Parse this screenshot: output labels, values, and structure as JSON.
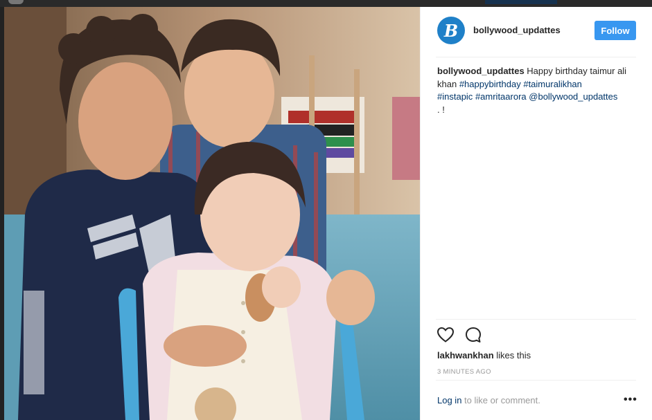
{
  "post": {
    "username": "bollywood_updattes",
    "avatar_letter": "B",
    "follow_label": "Follow",
    "caption": {
      "user": "bollywood_updattes",
      "text": " Happy birthday taimur ali khan ",
      "tags": [
        "#happybirthday",
        "#taimuralikhan",
        "#instapic",
        "#amritaarora",
        "@bollywood_updattes"
      ],
      "trailing": " . !"
    },
    "likes": {
      "liker": "lakhwankhan",
      "suffix": " likes this"
    },
    "timestamp": "3 MINUTES AGO",
    "login": {
      "link": "Log in",
      "rest": " to like or comment."
    },
    "more_label": "•••"
  },
  "icons": {
    "like": "heart-outline-icon",
    "comment": "comment-bubble-icon",
    "more": "more-options-icon"
  },
  "colors": {
    "follow_button": "#3897f0",
    "link": "#003569",
    "avatar": "#1f80c8"
  }
}
